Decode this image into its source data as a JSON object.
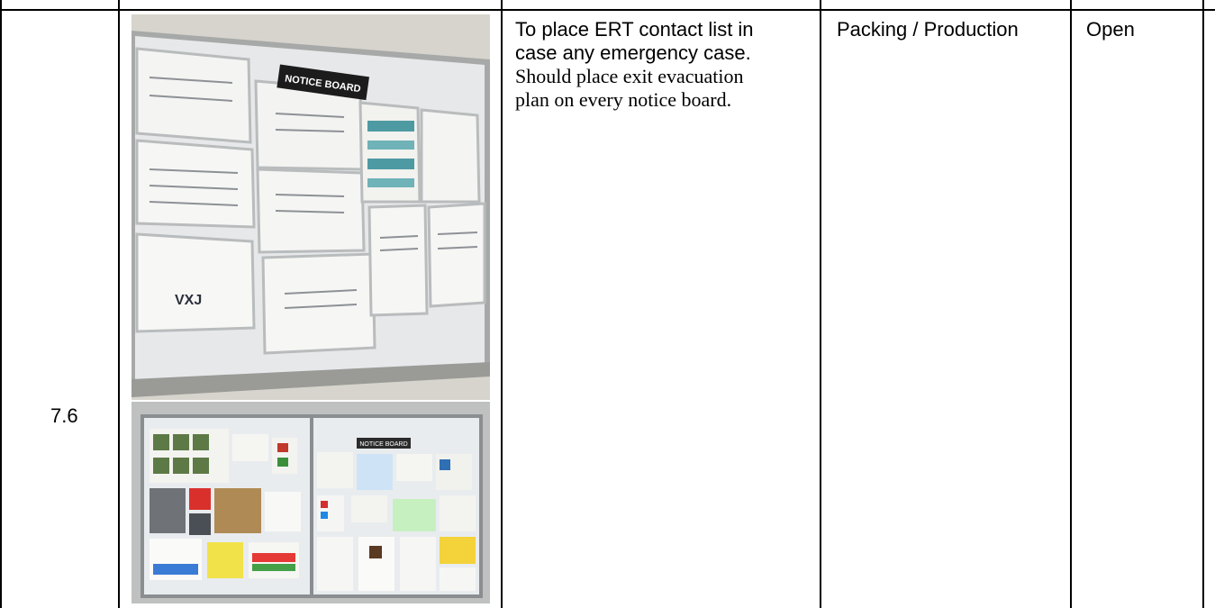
{
  "row": {
    "number": "7.6",
    "finding": {
      "line1": "To place ERT contact list in",
      "line2": "case any emergency case.",
      "line3": "Should place exit evacuation",
      "line4": "plan on every notice board."
    },
    "department": "Packing / Production",
    "status": "Open"
  },
  "photos": {
    "top_sign": "NOTICE BOARD",
    "top_logo": "VXJ",
    "bottom_sign": "NOTICE BOARD"
  },
  "colors": {
    "border": "#000000",
    "board_frame": "#b9bcbd",
    "board_bg": "#dfe3e7",
    "teal_chart": "#4e9aa3"
  }
}
